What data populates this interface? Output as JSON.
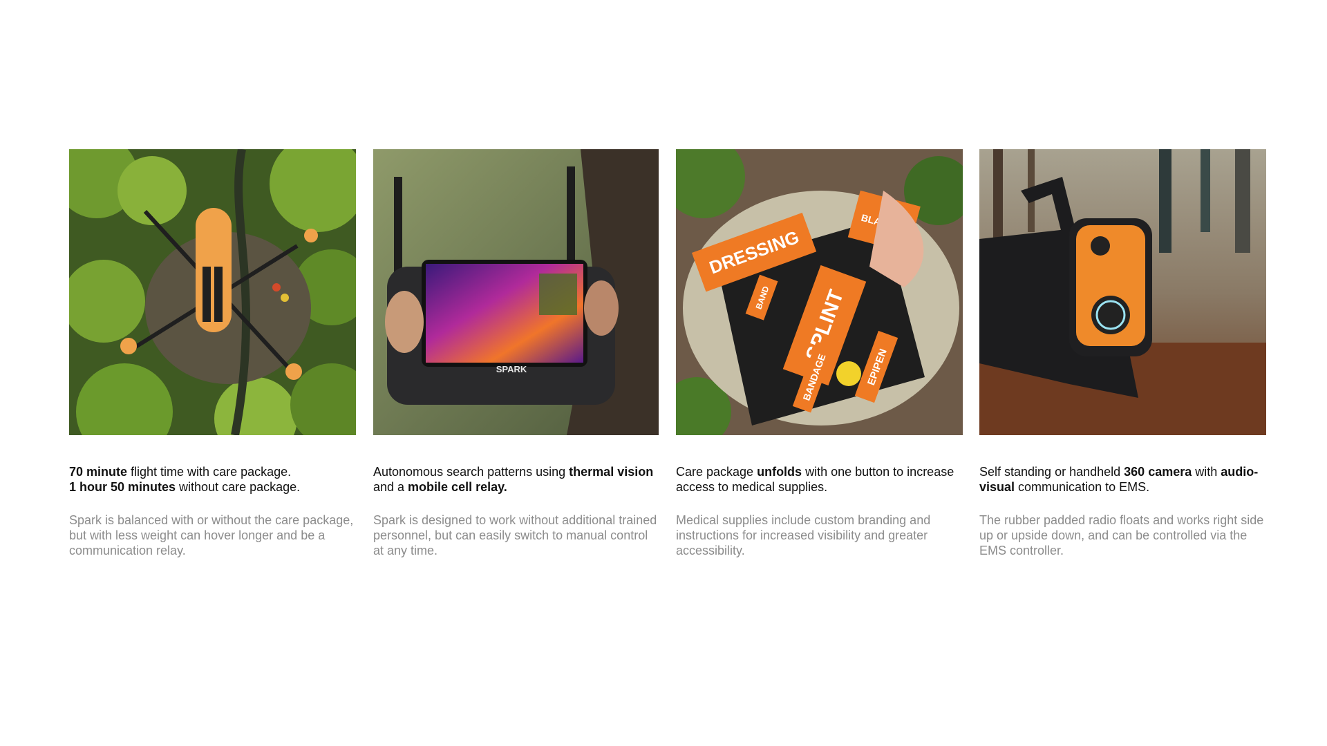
{
  "cards": [
    {
      "image_alt": "Orange drone flying over forest",
      "headline_parts": [
        {
          "text": "70 minute",
          "bold": true
        },
        {
          "text": " flight time with care package.",
          "bold": false
        },
        {
          "text": "1 hour 50 minutes",
          "bold": true
        },
        {
          "text": " without care package.",
          "bold": false
        }
      ],
      "body": "Spark is balanced with or without the care package, but with less weight can hover longer and be a communication relay."
    },
    {
      "image_alt": "SPARK handheld controller with thermal display",
      "screen_label": "SPARK",
      "headline_parts": [
        {
          "text": "Autonomous search patterns using ",
          "bold": false
        },
        {
          "text": "thermal vision",
          "bold": true
        },
        {
          "text": " and a ",
          "bold": false
        },
        {
          "text": "mobile cell relay.",
          "bold": true
        }
      ],
      "body": "Spark is designed to work without additional trained personnel, but can easily switch to manual control at any time."
    },
    {
      "image_alt": "Unfolded care package with medical supplies",
      "supply_labels": [
        "DRESSING",
        "SPLINT",
        "BANDAGE",
        "EPIPEN",
        "BLANKET",
        "BAND"
      ],
      "headline_parts": [
        {
          "text": "Care package ",
          "bold": false
        },
        {
          "text": "unfolds",
          "bold": true
        },
        {
          "text": " with one button to increase access to medical supplies.",
          "bold": false
        }
      ],
      "body": "Medical supplies include custom branding and instructions for increased visibility and greater accessibility."
    },
    {
      "image_alt": "Standing 360 camera radio in forest",
      "headline_parts": [
        {
          "text": "Self standing or handheld ",
          "bold": false
        },
        {
          "text": "360 camera",
          "bold": true
        },
        {
          "text": " with ",
          "bold": false
        },
        {
          "text": "audio-visual",
          "bold": true
        },
        {
          "text": " communication to EMS.",
          "bold": false
        }
      ],
      "body": "The rubber padded radio floats and works right side up or upside down, and can be controlled via the EMS controller."
    }
  ]
}
